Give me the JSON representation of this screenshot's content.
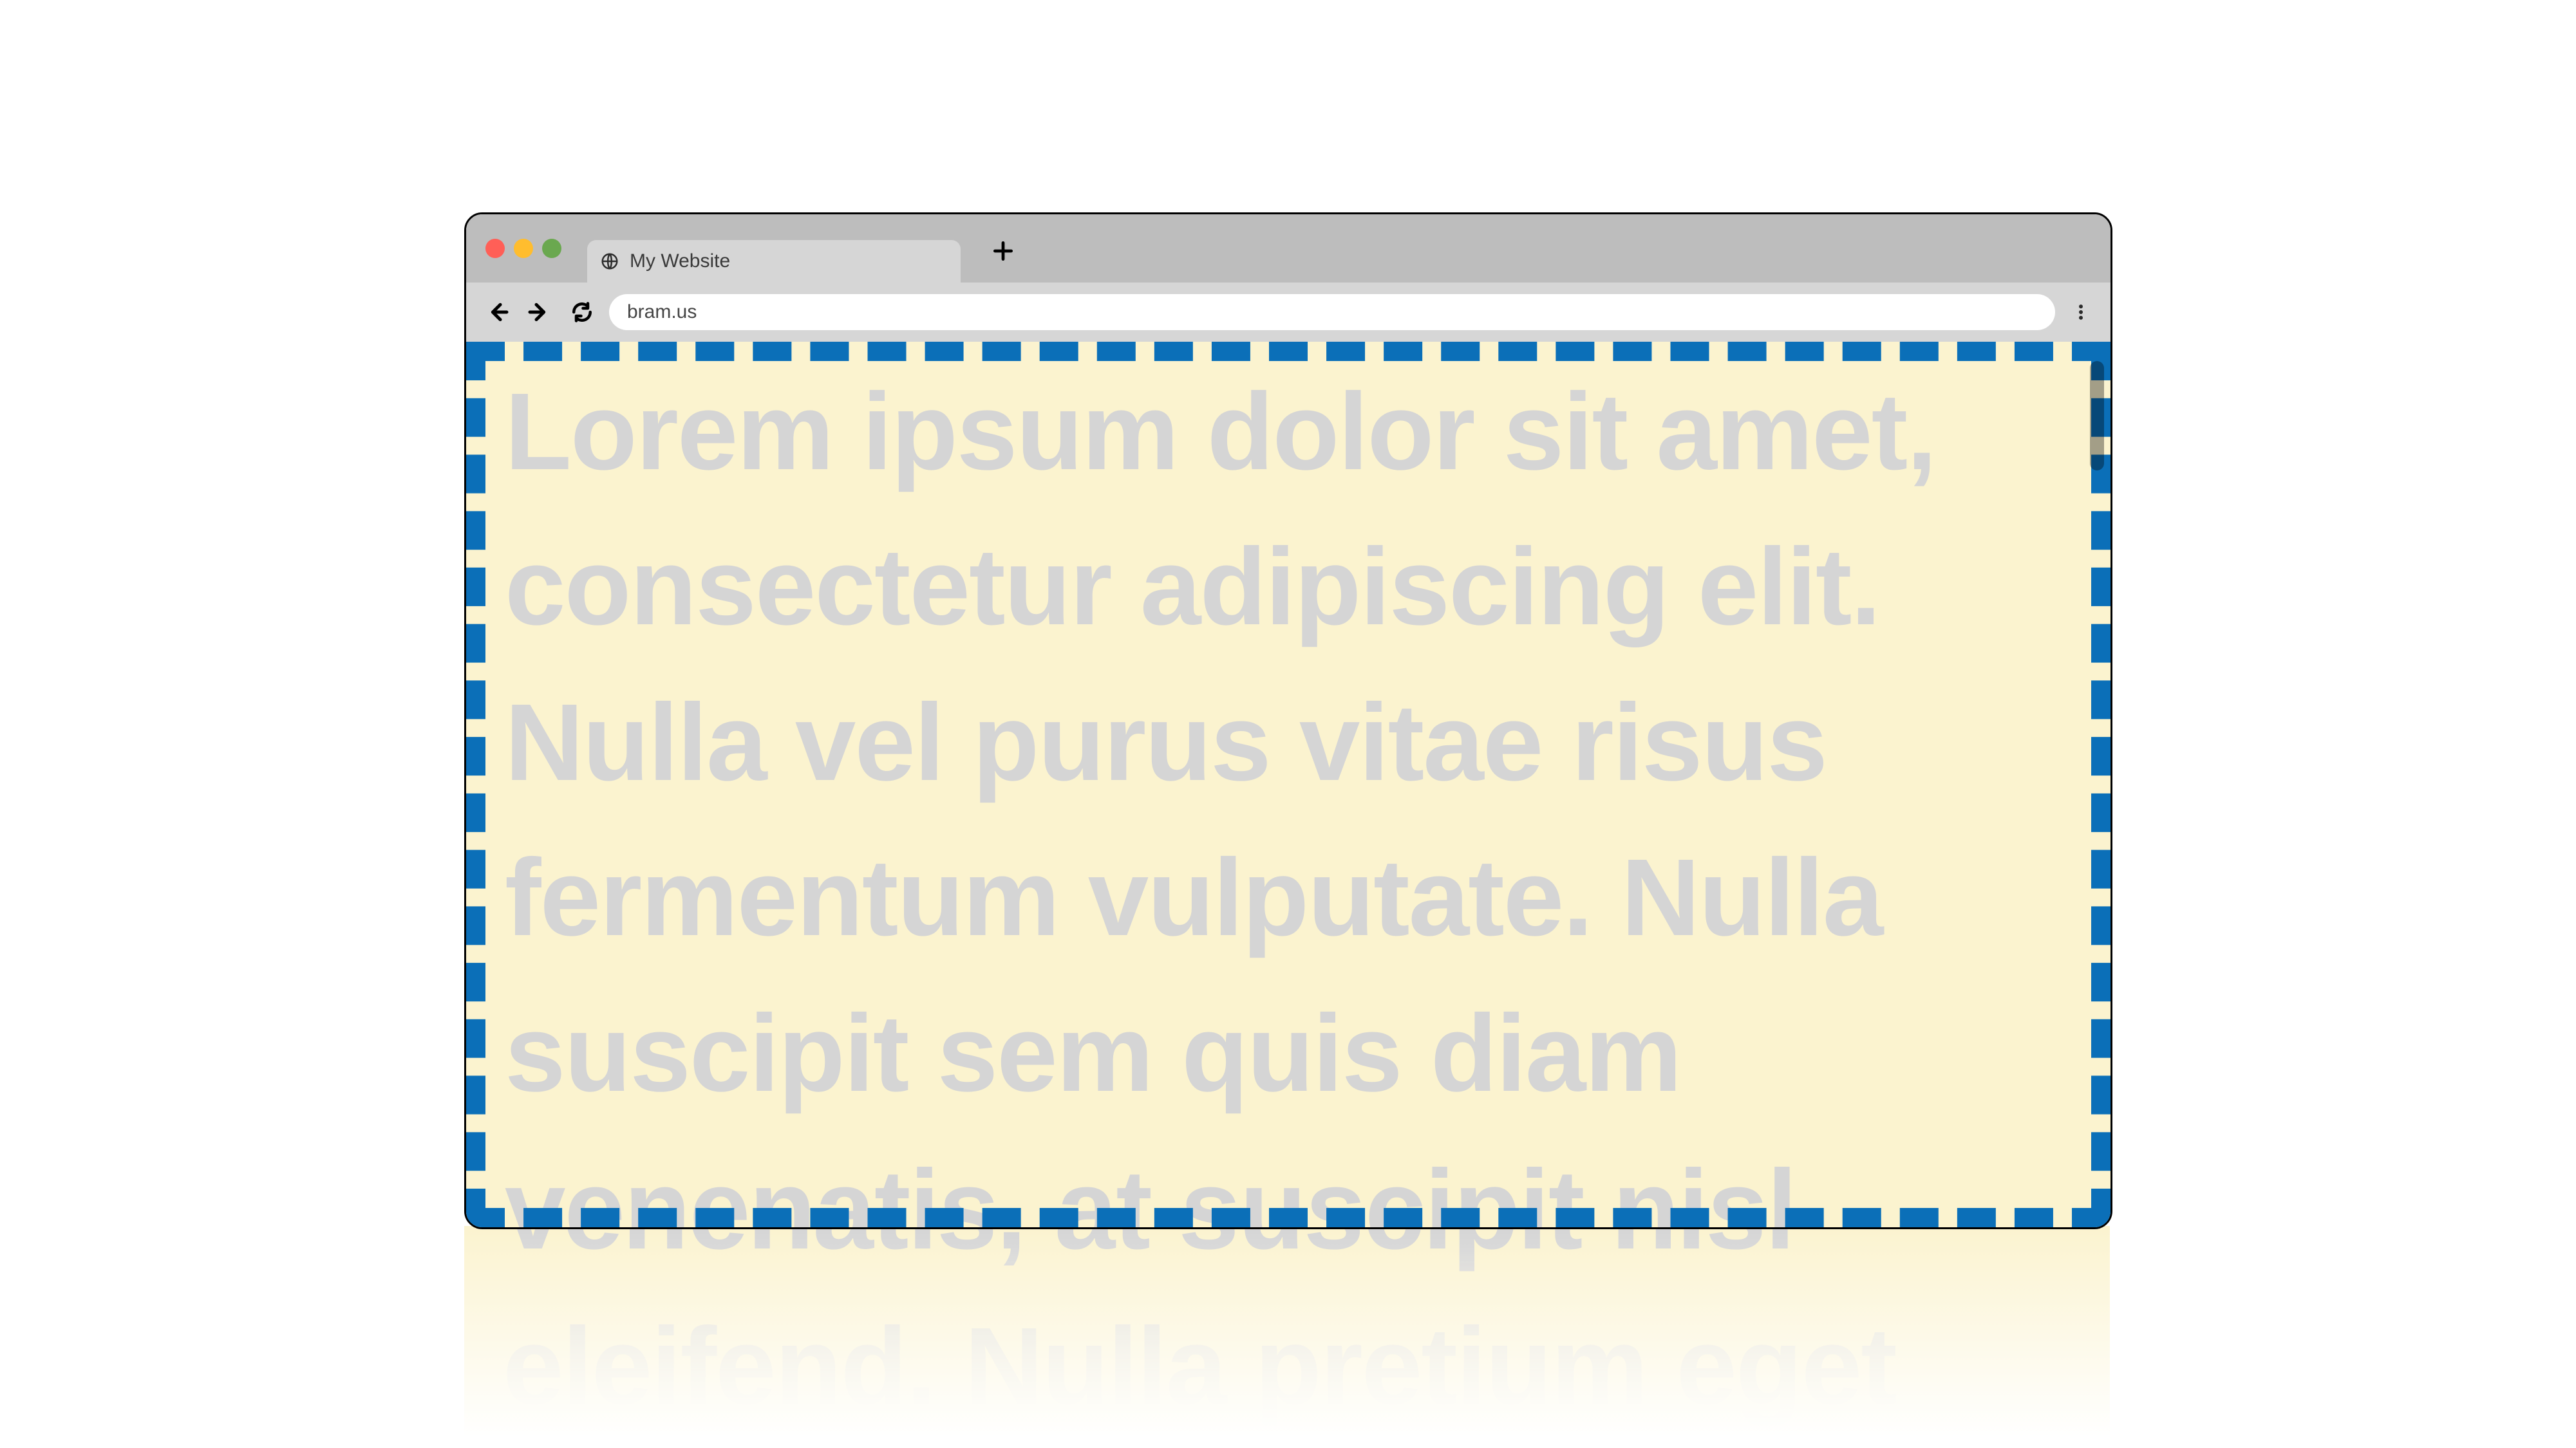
{
  "tab": {
    "title": "My Website",
    "favicon_name": "globe-icon"
  },
  "address": {
    "url": "bram.us"
  },
  "colors": {
    "viewport_bg": "#fbf3cf",
    "dashed_border": "#0b6fb8",
    "body_text": "#d5d5d5"
  },
  "content": {
    "paragraph": "Lorem ipsum dolor sit amet, consectetur adipiscing elit. Nulla vel purus vitae risus fermentum vulputate. Nulla suscipit sem quis diam venenatis, at suscipit nisl eleifend. Nulla pretium eget"
  }
}
